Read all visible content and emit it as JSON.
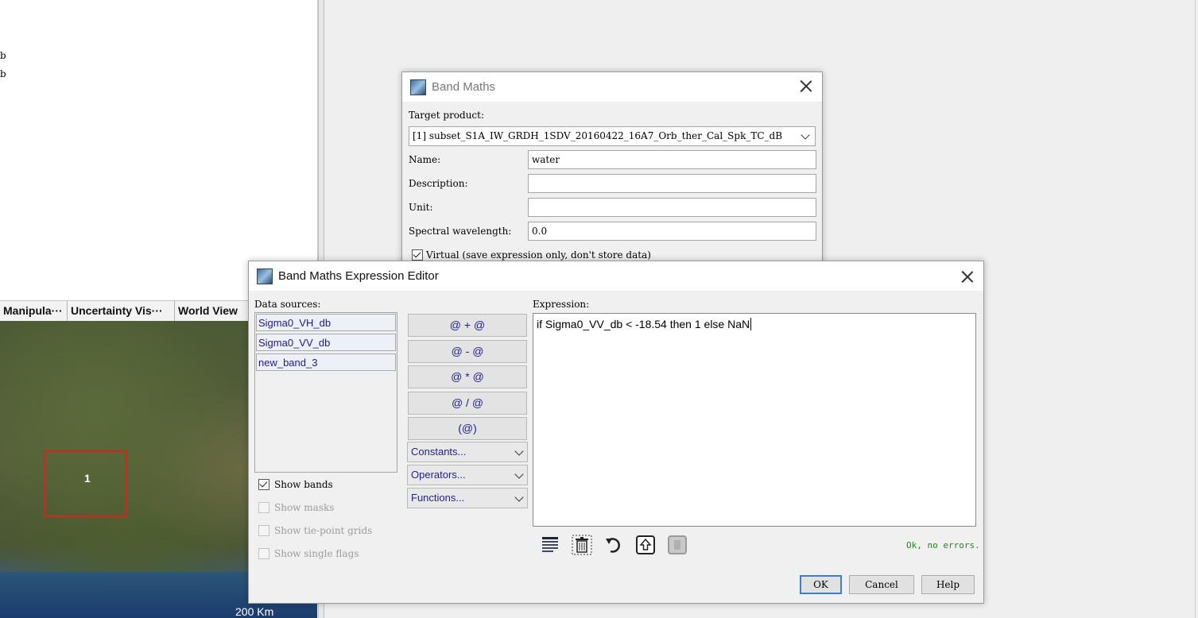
{
  "left_panel": {
    "tree_fragments": [
      "b",
      "b"
    ],
    "tabs": [
      "Manipula···",
      "Uncertainty Vis···",
      "World View"
    ],
    "map": {
      "aoi_label": "1",
      "scale_label": "200 Km"
    }
  },
  "band_maths": {
    "title": "Band Maths",
    "target_product_label": "Target product:",
    "target_product_value": "[1] subset_S1A_IW_GRDH_1SDV_20160422_16A7_Orb_ther_Cal_Spk_TC_dB",
    "name_label": "Name:",
    "name_value": "water",
    "description_label": "Description:",
    "description_value": "",
    "unit_label": "Unit:",
    "unit_value": "",
    "spectral_label": "Spectral wavelength:",
    "spectral_value": "0.0",
    "virtual_label": "Virtual (save expression only, don't store data)",
    "virtual_checked": true
  },
  "editor": {
    "title": "Band Maths Expression Editor",
    "data_sources_label": "Data sources:",
    "data_sources": [
      "Sigma0_VH_db",
      "Sigma0_VV_db",
      "new_band_3"
    ],
    "operator_buttons": [
      "@ + @",
      "@ - @",
      "@ * @",
      "@ / @",
      "(@)"
    ],
    "dropdowns": [
      "Constants...",
      "Operators...",
      "Functions..."
    ],
    "checkboxes": [
      {
        "label": "Show bands",
        "checked": true,
        "enabled": true
      },
      {
        "label": "Show masks",
        "checked": false,
        "enabled": false
      },
      {
        "label": "Show tie-point grids",
        "checked": false,
        "enabled": false
      },
      {
        "label": "Show single flags",
        "checked": false,
        "enabled": false
      }
    ],
    "expression_label": "Expression:",
    "expression": "if Sigma0_VV_db < -18.54 then 1 else NaN",
    "toolbar_icons": [
      "select-all-icon",
      "delete-icon",
      "undo-icon",
      "import-icon",
      "export-icon"
    ],
    "status": "Ok, no errors.",
    "status_color": "#1a8a1a",
    "ok_label": "OK",
    "cancel_label": "Cancel",
    "help_label": "Help"
  }
}
